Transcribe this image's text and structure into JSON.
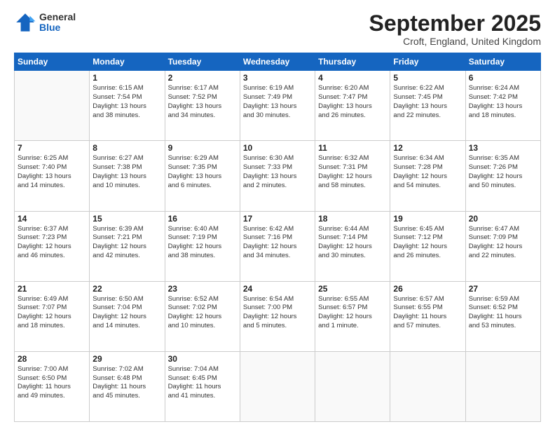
{
  "header": {
    "logo": {
      "general": "General",
      "blue": "Blue"
    },
    "title": "September 2025",
    "location": "Croft, England, United Kingdom"
  },
  "calendar": {
    "days_of_week": [
      "Sunday",
      "Monday",
      "Tuesday",
      "Wednesday",
      "Thursday",
      "Friday",
      "Saturday"
    ],
    "weeks": [
      [
        {
          "day": "",
          "info": ""
        },
        {
          "day": "1",
          "info": "Sunrise: 6:15 AM\nSunset: 7:54 PM\nDaylight: 13 hours\nand 38 minutes."
        },
        {
          "day": "2",
          "info": "Sunrise: 6:17 AM\nSunset: 7:52 PM\nDaylight: 13 hours\nand 34 minutes."
        },
        {
          "day": "3",
          "info": "Sunrise: 6:19 AM\nSunset: 7:49 PM\nDaylight: 13 hours\nand 30 minutes."
        },
        {
          "day": "4",
          "info": "Sunrise: 6:20 AM\nSunset: 7:47 PM\nDaylight: 13 hours\nand 26 minutes."
        },
        {
          "day": "5",
          "info": "Sunrise: 6:22 AM\nSunset: 7:45 PM\nDaylight: 13 hours\nand 22 minutes."
        },
        {
          "day": "6",
          "info": "Sunrise: 6:24 AM\nSunset: 7:42 PM\nDaylight: 13 hours\nand 18 minutes."
        }
      ],
      [
        {
          "day": "7",
          "info": "Sunrise: 6:25 AM\nSunset: 7:40 PM\nDaylight: 13 hours\nand 14 minutes."
        },
        {
          "day": "8",
          "info": "Sunrise: 6:27 AM\nSunset: 7:38 PM\nDaylight: 13 hours\nand 10 minutes."
        },
        {
          "day": "9",
          "info": "Sunrise: 6:29 AM\nSunset: 7:35 PM\nDaylight: 13 hours\nand 6 minutes."
        },
        {
          "day": "10",
          "info": "Sunrise: 6:30 AM\nSunset: 7:33 PM\nDaylight: 13 hours\nand 2 minutes."
        },
        {
          "day": "11",
          "info": "Sunrise: 6:32 AM\nSunset: 7:31 PM\nDaylight: 12 hours\nand 58 minutes."
        },
        {
          "day": "12",
          "info": "Sunrise: 6:34 AM\nSunset: 7:28 PM\nDaylight: 12 hours\nand 54 minutes."
        },
        {
          "day": "13",
          "info": "Sunrise: 6:35 AM\nSunset: 7:26 PM\nDaylight: 12 hours\nand 50 minutes."
        }
      ],
      [
        {
          "day": "14",
          "info": "Sunrise: 6:37 AM\nSunset: 7:23 PM\nDaylight: 12 hours\nand 46 minutes."
        },
        {
          "day": "15",
          "info": "Sunrise: 6:39 AM\nSunset: 7:21 PM\nDaylight: 12 hours\nand 42 minutes."
        },
        {
          "day": "16",
          "info": "Sunrise: 6:40 AM\nSunset: 7:19 PM\nDaylight: 12 hours\nand 38 minutes."
        },
        {
          "day": "17",
          "info": "Sunrise: 6:42 AM\nSunset: 7:16 PM\nDaylight: 12 hours\nand 34 minutes."
        },
        {
          "day": "18",
          "info": "Sunrise: 6:44 AM\nSunset: 7:14 PM\nDaylight: 12 hours\nand 30 minutes."
        },
        {
          "day": "19",
          "info": "Sunrise: 6:45 AM\nSunset: 7:12 PM\nDaylight: 12 hours\nand 26 minutes."
        },
        {
          "day": "20",
          "info": "Sunrise: 6:47 AM\nSunset: 7:09 PM\nDaylight: 12 hours\nand 22 minutes."
        }
      ],
      [
        {
          "day": "21",
          "info": "Sunrise: 6:49 AM\nSunset: 7:07 PM\nDaylight: 12 hours\nand 18 minutes."
        },
        {
          "day": "22",
          "info": "Sunrise: 6:50 AM\nSunset: 7:04 PM\nDaylight: 12 hours\nand 14 minutes."
        },
        {
          "day": "23",
          "info": "Sunrise: 6:52 AM\nSunset: 7:02 PM\nDaylight: 12 hours\nand 10 minutes."
        },
        {
          "day": "24",
          "info": "Sunrise: 6:54 AM\nSunset: 7:00 PM\nDaylight: 12 hours\nand 5 minutes."
        },
        {
          "day": "25",
          "info": "Sunrise: 6:55 AM\nSunset: 6:57 PM\nDaylight: 12 hours\nand 1 minute."
        },
        {
          "day": "26",
          "info": "Sunrise: 6:57 AM\nSunset: 6:55 PM\nDaylight: 11 hours\nand 57 minutes."
        },
        {
          "day": "27",
          "info": "Sunrise: 6:59 AM\nSunset: 6:52 PM\nDaylight: 11 hours\nand 53 minutes."
        }
      ],
      [
        {
          "day": "28",
          "info": "Sunrise: 7:00 AM\nSunset: 6:50 PM\nDaylight: 11 hours\nand 49 minutes."
        },
        {
          "day": "29",
          "info": "Sunrise: 7:02 AM\nSunset: 6:48 PM\nDaylight: 11 hours\nand 45 minutes."
        },
        {
          "day": "30",
          "info": "Sunrise: 7:04 AM\nSunset: 6:45 PM\nDaylight: 11 hours\nand 41 minutes."
        },
        {
          "day": "",
          "info": ""
        },
        {
          "day": "",
          "info": ""
        },
        {
          "day": "",
          "info": ""
        },
        {
          "day": "",
          "info": ""
        }
      ]
    ]
  }
}
